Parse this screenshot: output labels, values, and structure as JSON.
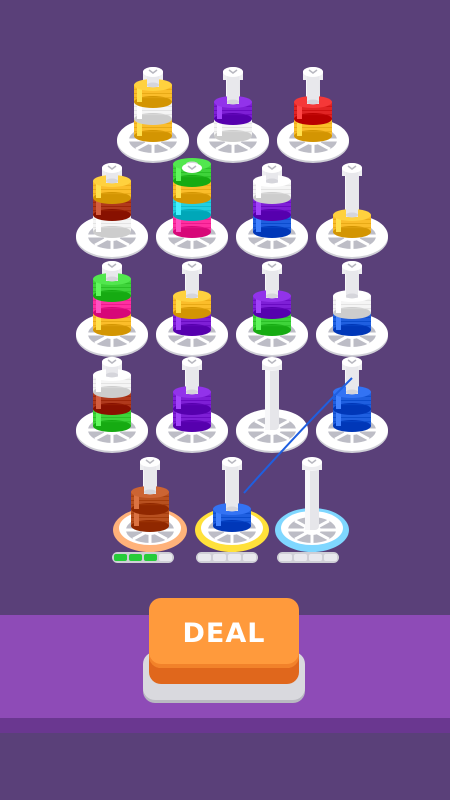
{
  "game": {
    "deal_button_label": "DEAL",
    "colors": {
      "background": "#5a4079",
      "strip": "#8e4bb7",
      "button": "#ff9a3c",
      "progress_on": "#26cc3a"
    },
    "spools": [
      {
        "row": 0,
        "col": 0,
        "threads": [
          "#fbbd2a",
          "#f5f5f5",
          "#fbbd2a"
        ]
      },
      {
        "row": 0,
        "col": 1,
        "threads": [
          "#f5f5f5",
          "#7e1fd6"
        ]
      },
      {
        "row": 0,
        "col": 2,
        "threads": [
          "#fbbd2a",
          "#e12424"
        ]
      },
      {
        "row": 1,
        "col": 0,
        "threads": [
          "#f5f5f5",
          "#b0391c",
          "#fbbd2a"
        ]
      },
      {
        "row": 1,
        "col": 1,
        "threads": [
          "#ff2fa0",
          "#22cfe0",
          "#fbbd2a",
          "#3ed33a"
        ]
      },
      {
        "row": 1,
        "col": 2,
        "threads": [
          "#1f5fe0",
          "#7e1fd6",
          "#f5f5f5"
        ]
      },
      {
        "row": 1,
        "col": 3,
        "threads": [
          "#fbbd2a"
        ]
      },
      {
        "row": 2,
        "col": 0,
        "threads": [
          "#fbbd2a",
          "#ff2fa0",
          "#3ed33a"
        ]
      },
      {
        "row": 2,
        "col": 1,
        "threads": [
          "#7e1fd6",
          "#fbbd2a"
        ]
      },
      {
        "row": 2,
        "col": 2,
        "threads": [
          "#3ed33a",
          "#7e1fd6"
        ]
      },
      {
        "row": 2,
        "col": 3,
        "threads": [
          "#1f5fe0",
          "#f5f5f5"
        ]
      },
      {
        "row": 3,
        "col": 0,
        "threads": [
          "#3ed33a",
          "#b0391c",
          "#f5f5f5"
        ]
      },
      {
        "row": 3,
        "col": 1,
        "threads": [
          "#7e1fd6",
          "#7e1fd6"
        ]
      },
      {
        "row": 3,
        "col": 2,
        "threads": []
      },
      {
        "row": 3,
        "col": 3,
        "threads": [
          "#1f5fe0",
          "#1f5fe0"
        ]
      }
    ],
    "target_spools": [
      {
        "ring": "#ffb27a",
        "threads": [
          "#b8501f",
          "#b8501f"
        ]
      },
      {
        "ring": "#ffe13a",
        "threads": [
          "#1f5fe0"
        ]
      },
      {
        "ring": "#7fd7ff",
        "threads": []
      }
    ],
    "progress": [
      {
        "filled": 3,
        "total": 4
      },
      {
        "filled": 0,
        "total": 4
      },
      {
        "filled": 0,
        "total": 4
      }
    ]
  }
}
